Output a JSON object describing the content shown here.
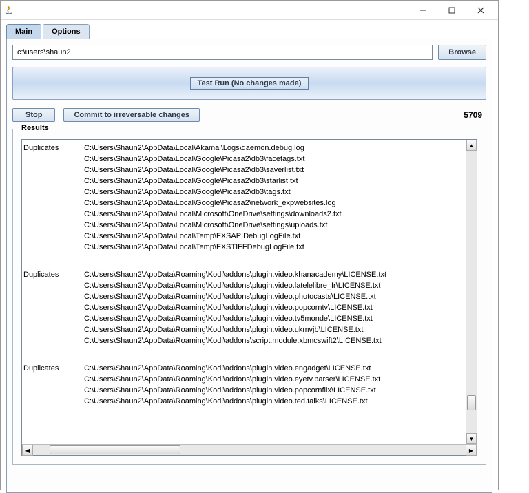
{
  "titlebar": {
    "icon": "java-icon"
  },
  "tabs": [
    {
      "label": "Main",
      "active": true
    },
    {
      "label": "Options",
      "active": false
    }
  ],
  "path": {
    "value": "c:\\users\\shaun2"
  },
  "buttons": {
    "browse": "Browse",
    "stop": "Stop",
    "commit": "Commit to irreversable changes",
    "test_run": "Test Run (No changes made)"
  },
  "count": "5709",
  "results_label": "Results",
  "groups": [
    {
      "header": "Duplicates",
      "files": [
        "C:\\Users\\Shaun2\\AppData\\Local\\Akamai\\Logs\\daemon.debug.log",
        "C:\\Users\\Shaun2\\AppData\\Local\\Google\\Picasa2\\db3\\facetags.txt",
        "C:\\Users\\Shaun2\\AppData\\Local\\Google\\Picasa2\\db3\\saverlist.txt",
        "C:\\Users\\Shaun2\\AppData\\Local\\Google\\Picasa2\\db3\\starlist.txt",
        "C:\\Users\\Shaun2\\AppData\\Local\\Google\\Picasa2\\db3\\tags.txt",
        "C:\\Users\\Shaun2\\AppData\\Local\\Google\\Picasa2\\network_expwebsites.log",
        "C:\\Users\\Shaun2\\AppData\\Local\\Microsoft\\OneDrive\\settings\\downloads2.txt",
        "C:\\Users\\Shaun2\\AppData\\Local\\Microsoft\\OneDrive\\settings\\uploads.txt",
        "C:\\Users\\Shaun2\\AppData\\Local\\Temp\\FXSAPIDebugLogFile.txt",
        "C:\\Users\\Shaun2\\AppData\\Local\\Temp\\FXSTIFFDebugLogFile.txt"
      ]
    },
    {
      "header": "Duplicates",
      "files": [
        "C:\\Users\\Shaun2\\AppData\\Roaming\\Kodi\\addons\\plugin.video.khanacademy\\LICENSE.txt",
        "C:\\Users\\Shaun2\\AppData\\Roaming\\Kodi\\addons\\plugin.video.latelelibre_fr\\LICENSE.txt",
        "C:\\Users\\Shaun2\\AppData\\Roaming\\Kodi\\addons\\plugin.video.photocasts\\LICENSE.txt",
        "C:\\Users\\Shaun2\\AppData\\Roaming\\Kodi\\addons\\plugin.video.popcorntv\\LICENSE.txt",
        "C:\\Users\\Shaun2\\AppData\\Roaming\\Kodi\\addons\\plugin.video.tv5monde\\LICENSE.txt",
        "C:\\Users\\Shaun2\\AppData\\Roaming\\Kodi\\addons\\plugin.video.ukmvjb\\LICENSE.txt",
        "C:\\Users\\Shaun2\\AppData\\Roaming\\Kodi\\addons\\script.module.xbmcswift2\\LICENSE.txt"
      ]
    },
    {
      "header": "Duplicates",
      "files": [
        "C:\\Users\\Shaun2\\AppData\\Roaming\\Kodi\\addons\\plugin.video.engadget\\LICENSE.txt",
        "C:\\Users\\Shaun2\\AppData\\Roaming\\Kodi\\addons\\plugin.video.eyetv.parser\\LICENSE.txt",
        "C:\\Users\\Shaun2\\AppData\\Roaming\\Kodi\\addons\\plugin.video.popcornflix\\LICENSE.txt",
        "C:\\Users\\Shaun2\\AppData\\Roaming\\Kodi\\addons\\plugin.video.ted.talks\\LICENSE.txt"
      ]
    }
  ]
}
